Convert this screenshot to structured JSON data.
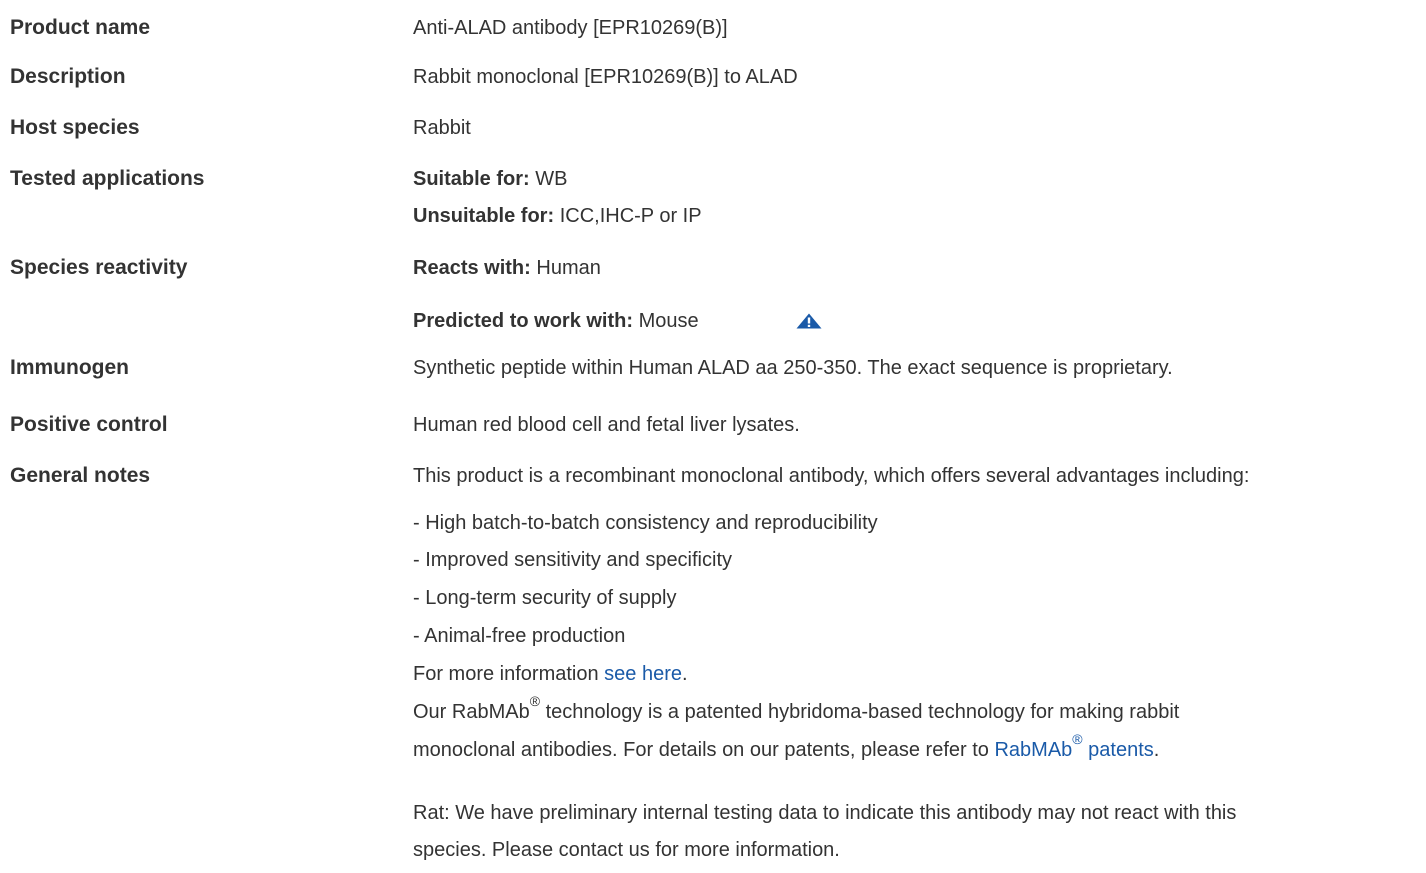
{
  "rows": {
    "product_name": {
      "label": "Product name",
      "value": "Anti-ALAD antibody [EPR10269(B)]"
    },
    "description": {
      "label": "Description",
      "value": "Rabbit monoclonal [EPR10269(B)] to ALAD"
    },
    "host_species": {
      "label": "Host species",
      "value": "Rabbit"
    },
    "tested_applications": {
      "label": "Tested applications",
      "suitable_label": "Suitable for:",
      "suitable_value": "WB",
      "unsuitable_label": "Unsuitable for:",
      "unsuitable_value": "ICC,IHC-P or IP"
    },
    "species_reactivity": {
      "label": "Species reactivity",
      "reacts_label": "Reacts with:",
      "reacts_value": "Human",
      "predicted_label": "Predicted to work with:",
      "predicted_value": "Mouse",
      "warning_icon": "warning-triangle-icon",
      "warning_color": "#1a5aa8"
    },
    "immunogen": {
      "label": "Immunogen",
      "value": "Synthetic peptide within Human ALAD aa 250-350. The exact sequence is proprietary."
    },
    "positive_control": {
      "label": "Positive control",
      "value": "Human red blood cell and fetal liver lysates."
    },
    "general_notes": {
      "label": "General notes",
      "intro": "This product is a recombinant monoclonal antibody, which offers several advantages including:",
      "bullets": [
        "- High batch-to-batch consistency and reproducibility",
        "- Improved sensitivity and specificity",
        "- Long-term security of supply",
        "- Animal-free production"
      ],
      "more_info_prefix": "For more information ",
      "more_info_link": "see here",
      "more_info_suffix": ".",
      "rabmab_line1_a": "Our RabMAb",
      "rabmab_reg": "®",
      "rabmab_line1_b": " technology is a patented hybridoma-based technology for making rabbit",
      "rabmab_line2_prefix": "monoclonal antibodies. For details on our patents, please refer to ",
      "rabmab_link_a": "RabMAb",
      "rabmab_link_reg": "®",
      "rabmab_link_b": " patents",
      "rabmab_line2_suffix": ".",
      "rat_line1": "Rat: We have preliminary internal testing data to indicate this antibody may not react with this",
      "rat_line2": "species. Please contact us for more information."
    }
  },
  "colors": {
    "text": "#333333",
    "link": "#1a5aa8"
  }
}
